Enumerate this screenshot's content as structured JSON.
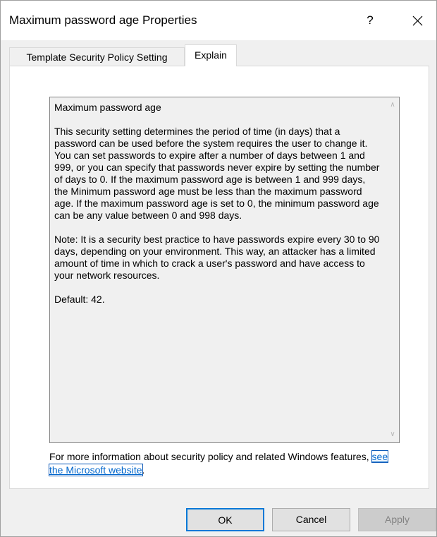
{
  "window": {
    "title": "Maximum password age Properties",
    "help_label": "?",
    "close_icon": "close-icon"
  },
  "tabs": [
    {
      "label": "Template Security Policy Setting",
      "active": false
    },
    {
      "label": "Explain",
      "active": true
    }
  ],
  "explain": {
    "text": "Maximum password age\n\nThis security setting determines the period of time (in days) that a password can be used before the system requires the user to change it. You can set passwords to expire after a number of days between 1 and 999, or you can specify that passwords never expire by setting the number of days to 0. If the maximum password age is between 1 and 999 days, the Minimum password age must be less than the maximum password age. If the maximum password age is set to 0, the minimum password age can be any value between 0 and 998 days.\n\nNote: It is a security best practice to have passwords expire every 30 to 90 days, depending on your environment. This way, an attacker has a limited amount of time in which to crack a user's password and have access to your network resources.\n\nDefault: 42."
  },
  "more_info": {
    "prefix": "For more information about security policy and related Windows features, ",
    "link_text": "see the Microsoft website",
    "suffix": "."
  },
  "buttons": {
    "ok": "OK",
    "cancel": "Cancel",
    "apply": "Apply"
  },
  "colors": {
    "link": "#0066cc",
    "focus_border": "#0078d7",
    "dialog_bg": "#f0f0f0"
  }
}
